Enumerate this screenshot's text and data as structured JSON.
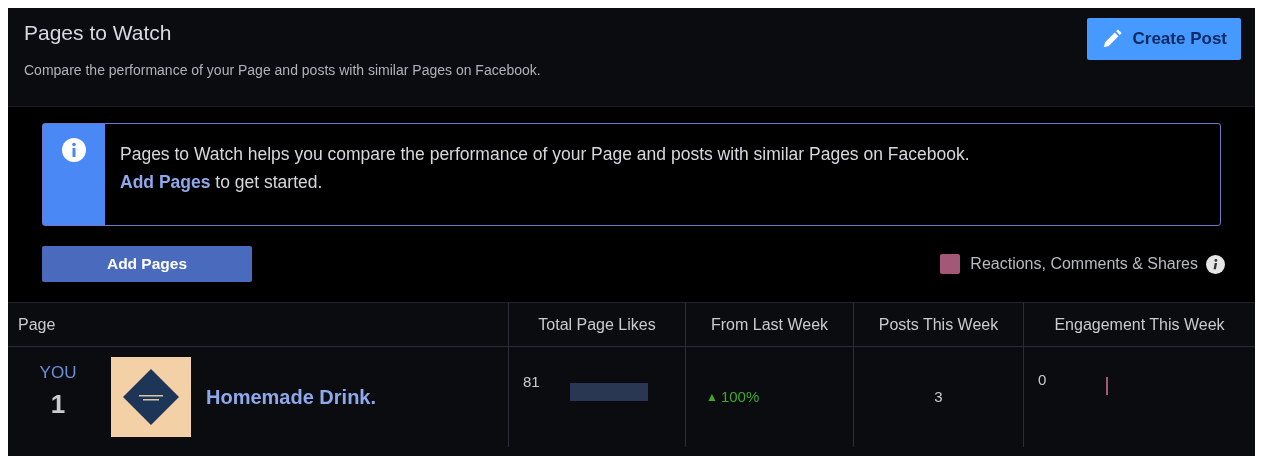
{
  "header": {
    "title": "Pages to Watch",
    "subtitle": "Compare the performance of your Page and posts with similar Pages on Facebook.",
    "create_button": "Create Post"
  },
  "info_banner": {
    "text_before": "Pages to Watch helps you compare the performance of your Page and posts with similar Pages on Facebook.",
    "link": "Add Pages",
    "text_after": " to get started."
  },
  "add_button": "Add Pages",
  "legend": [
    {
      "label": "Reactions, Comments & Shares",
      "color": "#a35877"
    }
  ],
  "table": {
    "columns": [
      "Page",
      "Total Page Likes",
      "From Last Week",
      "Posts This Week",
      "Engagement This Week"
    ],
    "rows": [
      {
        "badge": "YOU",
        "rank": "1",
        "name": "Homemade Drink.",
        "likes": "81",
        "change": {
          "arrow": "▲",
          "text": "100%"
        },
        "posts": "3",
        "engagement": "0"
      }
    ]
  }
}
